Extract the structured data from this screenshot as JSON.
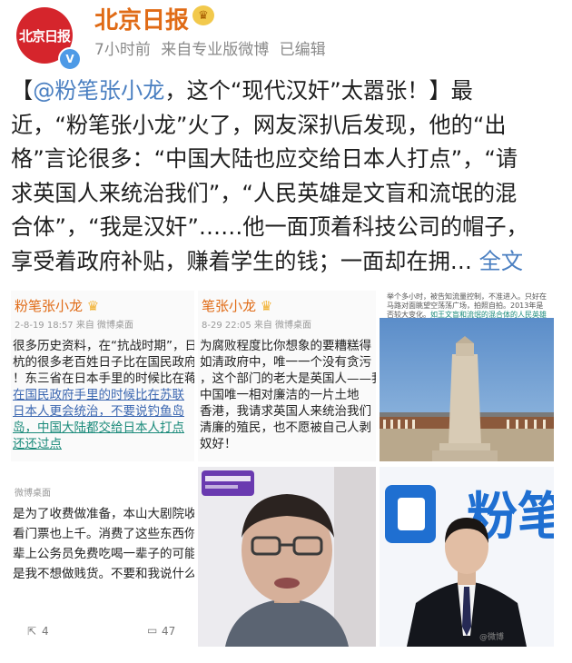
{
  "account": {
    "avatar_text": "北京日报",
    "name": "北京日报",
    "time": "7小时前",
    "source": "来自专业版微博",
    "edited": "已编辑"
  },
  "post": {
    "open_bracket": "【",
    "mention": "@粉笔张小龙",
    "line1_rest": "，这个“现代汉奸”太嚣张！】最",
    "line2": "近，“粉笔张小龙”火了，网友深扒后发现，他的“出",
    "line3": "格”言论很多：“中国大陆也应交给日本人打点”，“请",
    "line4": "求英国人来统治我们”，“人民英雄是文盲和流氓的混",
    "line5": "合体”，“我是汉奸”……他一面顶着科技公司的帽子，",
    "line6": "享受着政府补贴，赚着学生的钱；一面却在拥…",
    "more": "全文"
  },
  "images": {
    "img1": {
      "name": "粉笔张小龙",
      "meta": "2-8-19 18:57 来自 微博桌面",
      "lines": [
        "很多历史资料，在“抗战时期”，日",
        "杭的很多老百姓日子比在国民政府",
        "！东三省在日本手里的时候比在蒋",
        "在国民政府手里的时候比在苏联",
        "日本人更会统治，不要说钓鱼岛",
        "岛，中国大陆都交给日本人打点",
        "还还过点"
      ]
    },
    "img2": {
      "name": "笔张小龙",
      "meta": "8-29 22:05 来自 微博桌面",
      "lines": [
        "为腐败程度比你想象的要糟糕得",
        "如清政府中，唯一一个没有贪污",
        "，这个部门的老大是英国人——我",
        "中国唯一相对廉洁的一片土地",
        "香港，我请求英国人来统治我们",
        "清廉的殖民，也不愿被自己人剥",
        "奴好！"
      ]
    },
    "img3": {
      "caption_top": "举个多小时，被告知流量控制，不准进入。只好在马路对面眺望空荡荡广场，拍照自拍。2013年是否较大变化。",
      "caption_hl": "如王文盲和流氓的混合体的人民英雄"
    },
    "img4": {
      "meta": "微博桌面",
      "lines": [
        "是为了收费做准备，本山大剧院收",
        "看门票也上千。消费了这些东西你",
        "辈上公务员免费吃喝一辈子的可能",
        "是我不想做贱货。不要和我说什么"
      ],
      "repost_count": "4",
      "comment_count": "47"
    },
    "img6": {
      "brand_text": "粉笔",
      "watermark": "@微博"
    }
  }
}
